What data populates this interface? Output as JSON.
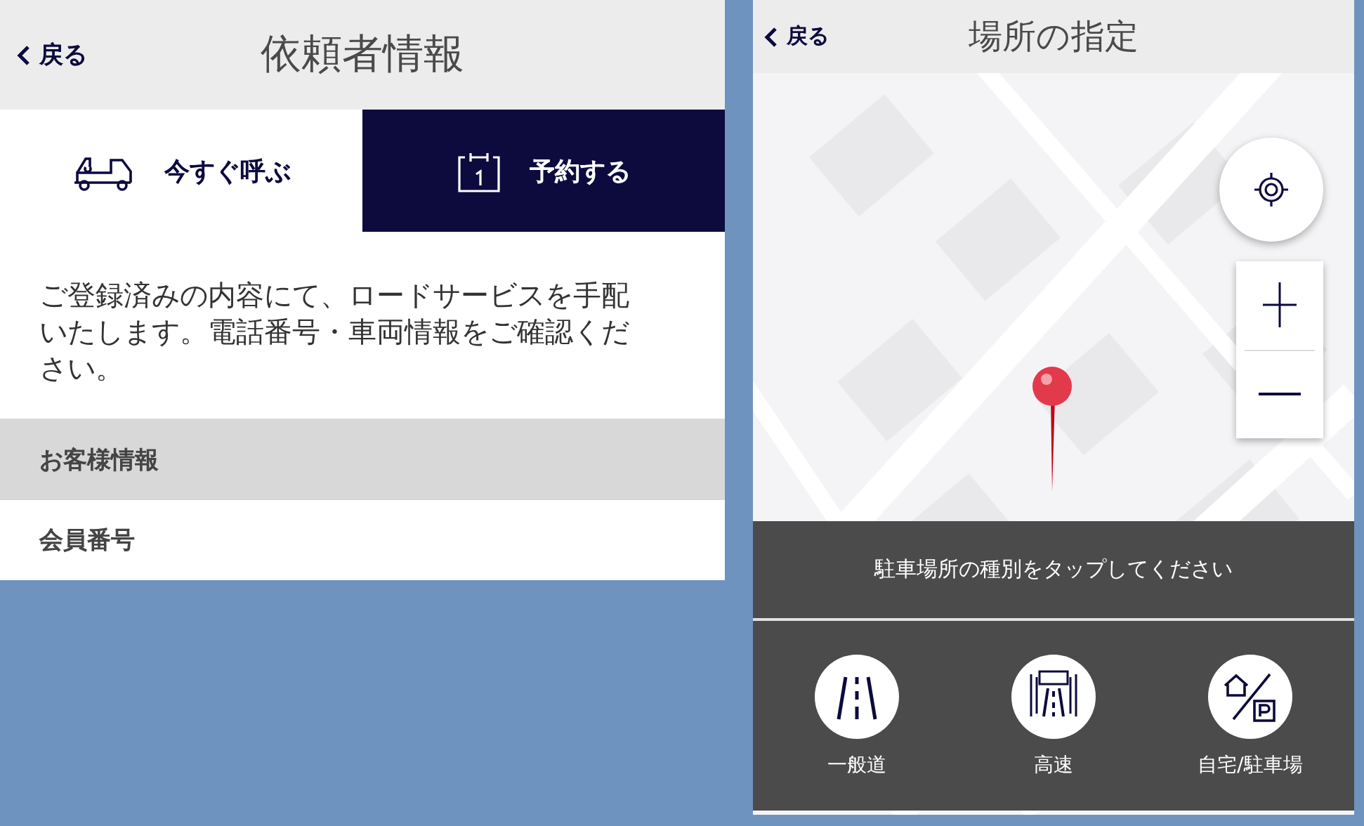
{
  "request_screen": {
    "header": {
      "back": "戻る",
      "title": "依頼者情報"
    },
    "tabs": [
      {
        "label": "今すぐ呼ぶ",
        "kind": "truck",
        "selected": true
      },
      {
        "label": "予約する",
        "kind": "calendar",
        "selected": false
      }
    ],
    "message": "ご登録済みの内容にて、ロードサービスを手配いたします。電話番号・車両情報をご確認ください。",
    "section_header": "お客様情報",
    "fields": [
      {
        "label": "会員番号"
      }
    ]
  },
  "location_screen": {
    "header": {
      "back": "戻る",
      "title": "場所の指定"
    },
    "prompt": "駐車場所の種別をタップしてください",
    "options": [
      {
        "label": "一般道",
        "kind": "road"
      },
      {
        "label": "高速",
        "kind": "highway"
      },
      {
        "label": "自宅/駐車場",
        "kind": "home"
      }
    ]
  }
}
